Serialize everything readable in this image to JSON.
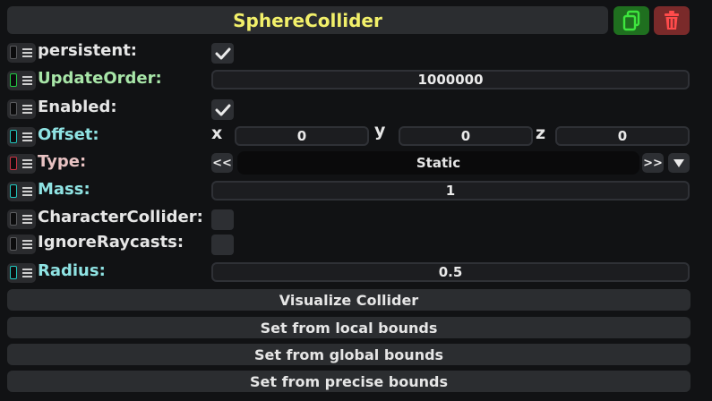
{
  "header": {
    "title": "SphereCollider",
    "duplicate_icon": "duplicate-icon",
    "delete_icon": "trash-icon"
  },
  "fields": {
    "persistent": {
      "label": "persistent:",
      "checked": true
    },
    "update_order": {
      "label": "UpdateOrder:",
      "value": "1000000"
    },
    "enabled": {
      "label": "Enabled:",
      "checked": true
    },
    "offset": {
      "label": "Offset:",
      "x_label": "x",
      "x": "0",
      "y_label": "y",
      "y": "0",
      "z_label": "z",
      "z": "0"
    },
    "type": {
      "label": "Type:",
      "value": "Static",
      "prev": "<<",
      "next": ">>",
      "dropdown_icon": "triangle-down-icon"
    },
    "mass": {
      "label": "Mass:",
      "value": "1"
    },
    "character_collider": {
      "label": "CharacterCollider:",
      "checked": false
    },
    "ignore_raycasts": {
      "label": "IgnoreRaycasts:",
      "checked": false
    },
    "radius": {
      "label": "Radius:",
      "value": "0.5"
    }
  },
  "actions": {
    "visualize": "Visualize Collider",
    "local_bounds": "Set from local bounds",
    "global_bounds": "Set from global bounds",
    "precise_bounds": "Set from precise bounds"
  },
  "colors": {
    "title": "#f2f06a",
    "label_default": "#e6e6e6",
    "label_green": "#a8e6a8",
    "label_cyan": "#8fe3e3",
    "label_pink": "#e9c3c3",
    "handle_green": "#22cc44",
    "handle_cyan": "#22c8c0",
    "handle_red": "#cc3344",
    "duplicate_bg": "#1f6f1f",
    "delete_bg": "#7a2a2a"
  }
}
